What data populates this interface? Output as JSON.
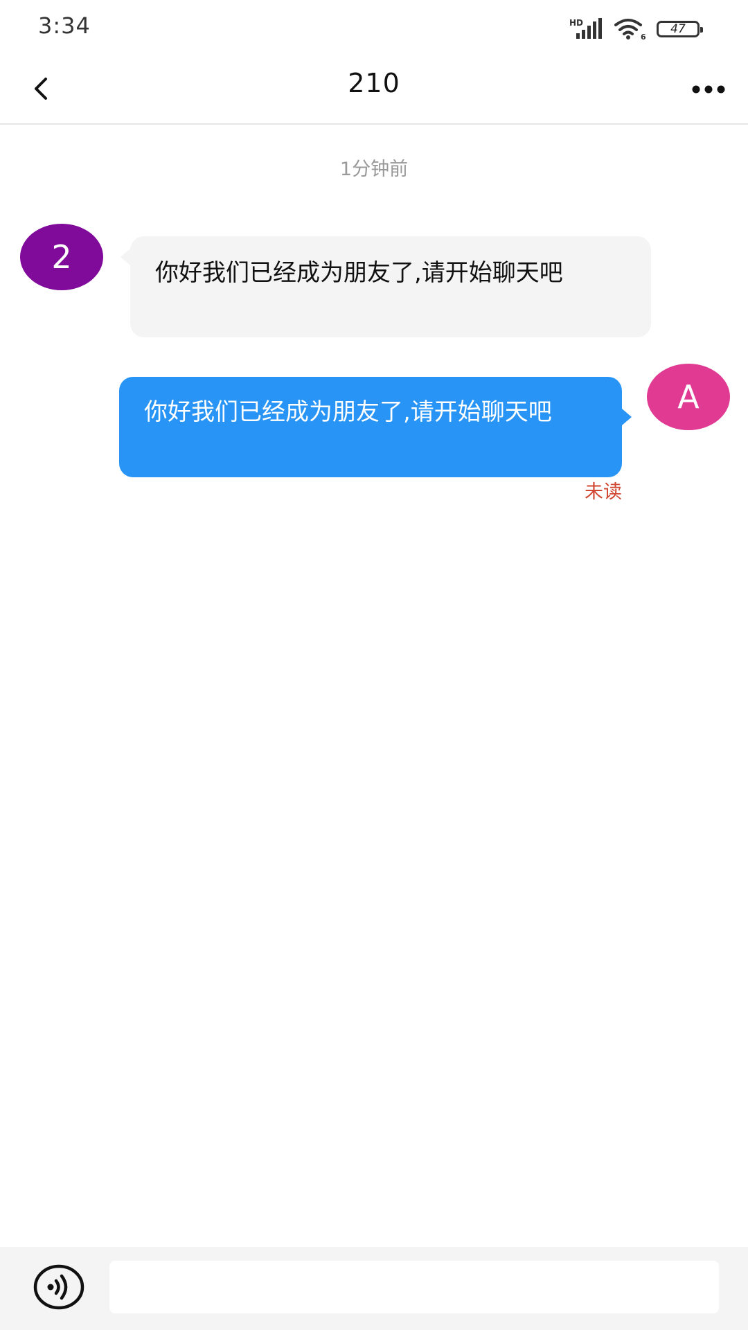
{
  "status_bar": {
    "time": "3:34",
    "network_label": "HD",
    "wifi_label": "6",
    "battery_level": "47",
    "icons": [
      "hd-signal-icon",
      "wifi-icon",
      "battery-icon"
    ]
  },
  "nav": {
    "title": "210",
    "back_icon": "chevron-left-icon",
    "more_icon": "more-dots-icon"
  },
  "chat": {
    "time_divider": "1分钟前",
    "messages": [
      {
        "side": "left",
        "avatar_text": "2",
        "avatar_color": "#800a9a",
        "text": "你好我们已经成为朋友了,请开始聊天吧",
        "bubble_color": "#f4f4f4"
      },
      {
        "side": "right",
        "avatar_text": "A",
        "avatar_color": "#e03a93",
        "text": "你好我们已经成为朋友了,请开始聊天吧",
        "bubble_color": "#2895f6",
        "read_status": "未读",
        "read_status_color": "#d0452f"
      }
    ]
  },
  "input_bar": {
    "voice_icon": "voice-input-icon",
    "input_value": "",
    "input_placeholder": ""
  }
}
